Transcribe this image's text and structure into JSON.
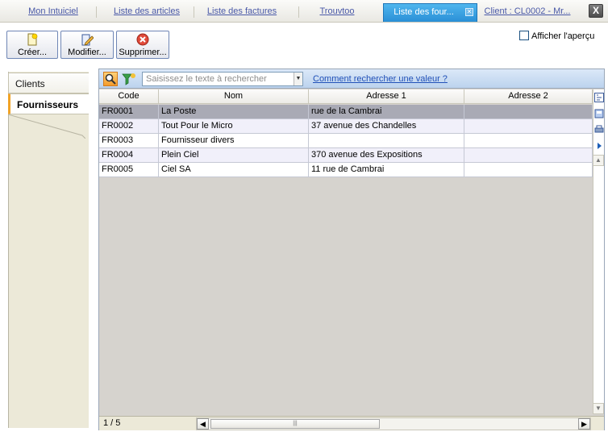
{
  "tabs": [
    {
      "label": "Mon Intuiciel",
      "active": false
    },
    {
      "label": "Liste des articles",
      "active": false
    },
    {
      "label": "Liste des factures",
      "active": false
    },
    {
      "label": "Trouvtoo",
      "active": false
    },
    {
      "label": "Liste des four...",
      "active": true
    },
    {
      "label": "Client : CL0002 - Mr...",
      "active": false
    }
  ],
  "window_close": "X",
  "toolbar": {
    "create_label": "Créer...",
    "modify_label": "Modifier...",
    "delete_label": "Supprimer..."
  },
  "preview": {
    "label": "Afficher l'aperçu",
    "checked": false
  },
  "side_tabs": [
    {
      "label": "Clients",
      "active": false
    },
    {
      "label": "Fournisseurs",
      "active": true
    }
  ],
  "search": {
    "placeholder": "Saisissez le texte à rechercher",
    "help_link": "Comment rechercher une valeur ?"
  },
  "table": {
    "columns": [
      "Code",
      "Nom",
      "Adresse 1",
      "Adresse 2"
    ],
    "rows": [
      {
        "code": "FR0001",
        "nom": "La Poste",
        "adresse1": "rue de la Cambrai",
        "adresse2": "",
        "selected": true
      },
      {
        "code": "FR0002",
        "nom": "Tout Pour le Micro",
        "adresse1": "37 avenue des Chandelles",
        "adresse2": ""
      },
      {
        "code": "FR0003",
        "nom": "Fournisseur divers",
        "adresse1": "",
        "adresse2": ""
      },
      {
        "code": "FR0004",
        "nom": "Plein Ciel",
        "adresse1": "370 avenue des Expositions",
        "adresse2": ""
      },
      {
        "code": "FR0005",
        "nom": "Ciel SA",
        "adresse1": "11 rue de Cambrai",
        "adresse2": ""
      }
    ]
  },
  "status": {
    "page_count": "1 / 5"
  },
  "colors": {
    "active_tab": "#2a8fd6",
    "link": "#2050b8",
    "selected_row": "#a9aab5",
    "grid_empty": "#d6d3ce",
    "side_accent": "#f1a326"
  }
}
